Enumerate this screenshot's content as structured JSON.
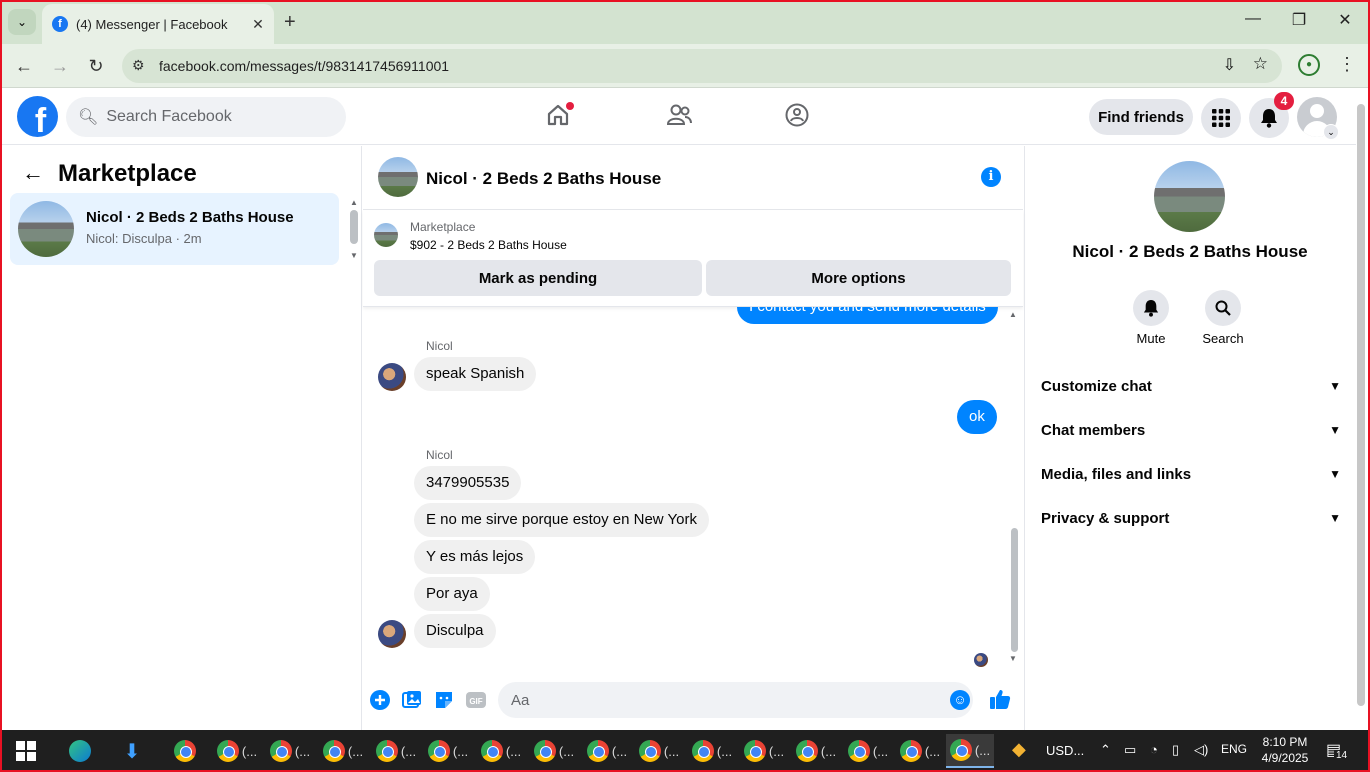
{
  "browser": {
    "tab_title": "(4) Messenger | Facebook",
    "url": "facebook.com/messages/t/9831417456911001",
    "new_tab_symbol": "+",
    "close_tab_symbol": "✕",
    "window_controls": [
      "—",
      "❐",
      "✕"
    ]
  },
  "header": {
    "logo_letter": "f",
    "search_placeholder": "Search Facebook",
    "find_friends": "Find friends",
    "notification_count": "4",
    "nav_icons": [
      "home-icon",
      "friends-icon",
      "groups-icon"
    ],
    "accent": "#1877f2"
  },
  "left": {
    "title": "Marketplace",
    "conversations": [
      {
        "name": "Nicol · 2 Beds 2 Baths House",
        "snippet": "Nicol: Disculpa · 2m"
      }
    ]
  },
  "chat": {
    "title": "Nicol · 2 Beds 2 Baths House",
    "listing_source": "Marketplace",
    "listing": "$902 - 2 Beds 2 Baths House",
    "mark_pending": "Mark as pending",
    "more_options": "More options",
    "messages": {
      "partial_outgoing": "I contact you and send more details",
      "sender1": "Nicol",
      "m1": "speak Spanish",
      "m2": "ok",
      "sender2": "Nicol",
      "m3": "3479905535",
      "m4": "E no me sirve porque estoy en New York",
      "m5": "Y es más lejos",
      "m6": "Por aya",
      "m7": "Disculpa"
    },
    "composer_placeholder": "Aa",
    "me_color": "#0084ff"
  },
  "right": {
    "name": "Nicol · 2 Beds 2 Baths House",
    "mute": "Mute",
    "search": "Search",
    "sections": [
      "Customize chat",
      "Chat members",
      "Media, files and links",
      "Privacy & support"
    ]
  },
  "taskbar": {
    "ellipsis": "(...",
    "stock": "USD...",
    "lang": "ENG",
    "time": "8:10 PM",
    "date": "4/9/2025",
    "notif_count": "14"
  }
}
